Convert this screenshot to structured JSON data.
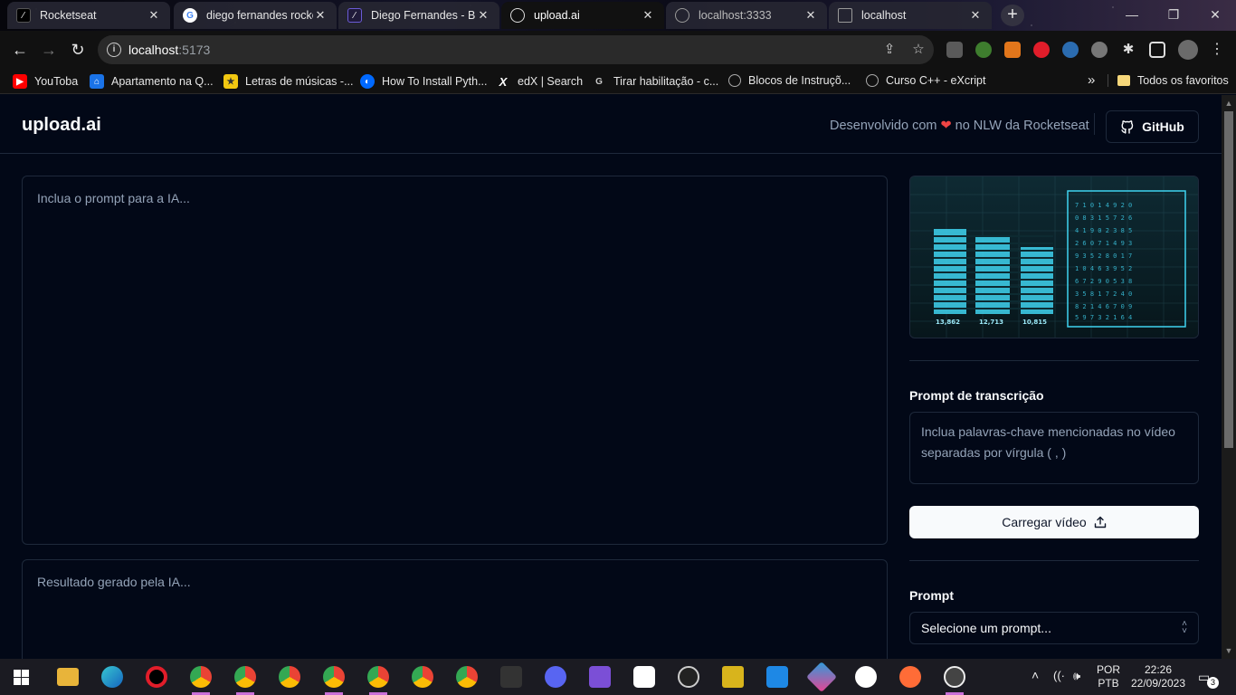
{
  "browser": {
    "tabs": [
      {
        "title": "Rocketseat",
        "favicon": "rocketseat-icon",
        "active": false
      },
      {
        "title": "diego fernandes rocke",
        "favicon": "google-icon",
        "active": false
      },
      {
        "title": "Diego Fernandes - Bl",
        "favicon": "rocketseat-icon",
        "active": false
      },
      {
        "title": "upload.ai",
        "favicon": "globe-icon",
        "active": true
      },
      {
        "title": "localhost:3333",
        "favicon": "globe-icon",
        "active": false
      },
      {
        "title": "localhost",
        "favicon": "page-icon",
        "active": false
      }
    ],
    "url_host": "localhost",
    "url_port": ":5173",
    "bookmarks": [
      {
        "label": "YouToba",
        "icon": "youtube-icon",
        "color": "#ff0000"
      },
      {
        "label": "Apartamento na Q...",
        "icon": "site-icon",
        "color": "#1a73e8"
      },
      {
        "label": "Letras de músicas -...",
        "icon": "star-icon",
        "color": "#f2c811"
      },
      {
        "label": "How To Install Pyth...",
        "icon": "digitalocean-icon",
        "color": "#0069ff"
      },
      {
        "label": "edX | Search",
        "icon": "edx-icon",
        "color": "#ffffff"
      },
      {
        "label": "Tirar habilitação - c...",
        "icon": "g-icon",
        "color": "#cccccc"
      },
      {
        "label": "Blocos de Instruçõ...",
        "icon": "globe-icon",
        "color": "#aaaaaa"
      },
      {
        "label": "Curso C++ - eXcript",
        "icon": "globe-icon",
        "color": "#aaaaaa"
      }
    ],
    "bookmarks_overflow": "»",
    "all_bookmarks": "Todos os favoritos"
  },
  "app": {
    "logo": "upload.ai",
    "credit_before": "Desenvolvido com",
    "credit_after": "no NLW da Rocketseat",
    "github_label": "GitHub",
    "prompt_placeholder": "Inclua o prompt para a IA...",
    "result_placeholder": "Resultado gerado pela IA...",
    "video_preview": {
      "numbers": [
        "13,862",
        "12,713",
        "10,815"
      ]
    },
    "transcription_label": "Prompt de transcrição",
    "transcription_placeholder": "Inclua palavras-chave mencionadas no vídeo separadas por vírgula ( , )",
    "upload_button": "Carregar vídeo",
    "prompt_label": "Prompt",
    "prompt_select": "Selecione um prompt..."
  },
  "taskbar": {
    "lang_1": "POR",
    "lang_2": "PTB",
    "time": "22:26",
    "date": "22/09/2023",
    "notifications": "3"
  },
  "colors": {
    "background": "#020817",
    "border": "#1e293b",
    "muted_text": "#94a3b8",
    "primary_button": "#f8fafc",
    "heart": "#ef4444"
  }
}
